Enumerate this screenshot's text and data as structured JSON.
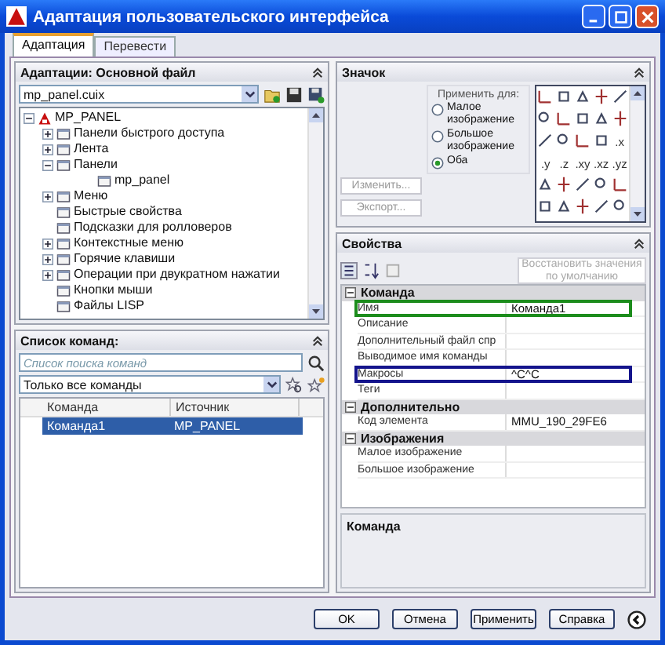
{
  "window": {
    "title": "Адаптация пользовательского интерфейса"
  },
  "tabs": [
    {
      "label": "Адаптация",
      "selected": true
    },
    {
      "label": "Перевести",
      "selected": false
    }
  ],
  "customizations_panel": {
    "title": "Адаптации: Основной файл",
    "expanded": true,
    "file": "mp_panel.cuix",
    "tree": [
      {
        "label": "MP_PANEL",
        "expanded": true,
        "children": [
          {
            "label": "Панели быстрого доступа",
            "expanded": false
          },
          {
            "label": "Лента",
            "expanded": false
          },
          {
            "label": "Панели",
            "expanded": true,
            "children": [
              {
                "label": "mp_panel"
              }
            ]
          },
          {
            "label": "Меню",
            "expanded": false
          },
          {
            "label": "Быстрые свойства"
          },
          {
            "label": "Подсказки для ролловеров"
          },
          {
            "label": "Контекстные меню",
            "expanded": false
          },
          {
            "label": "Горячие клавиши",
            "expanded": false
          },
          {
            "label": "Операции при двукратном нажатии",
            "expanded": false
          },
          {
            "label": "Кнопки мыши"
          },
          {
            "label": "Файлы LISP"
          }
        ]
      }
    ]
  },
  "command_list": {
    "title": "Список команд:",
    "expanded": true,
    "search": {
      "placeholder": "Список поиска команд"
    },
    "filter": "Только все команды",
    "columns": [
      "Команда",
      "Источник"
    ],
    "rows": [
      {
        "cells": [
          "Команда1",
          "MP_PANEL"
        ],
        "selected": true
      }
    ]
  },
  "icon_panel": {
    "title": "Значок",
    "expanded": true,
    "apply_label": "Применить для:",
    "options": [
      {
        "label": "Малое изображение",
        "selected": false
      },
      {
        "label": "Большое изображение",
        "selected": false
      },
      {
        "label": "Оба",
        "selected": true
      }
    ],
    "buttons": [
      {
        "label": "Изменить...",
        "disabled": true
      },
      {
        "label": "Экспорт...",
        "disabled": true
      }
    ],
    "icons": [
      {
        "kind": "icon"
      },
      {
        "kind": "icon"
      },
      {
        "kind": "icon"
      },
      {
        "kind": "icon"
      },
      {
        "kind": "icon"
      },
      {
        "kind": "icon"
      },
      {
        "kind": "icon"
      },
      {
        "kind": "icon"
      },
      {
        "kind": "icon"
      },
      {
        "kind": "icon"
      },
      {
        "kind": "icon"
      },
      {
        "kind": "icon"
      },
      {
        "kind": "icon"
      },
      {
        "kind": "icon"
      },
      {
        "kind": "text",
        "label": ".x"
      },
      {
        "kind": "text",
        "label": ".y"
      },
      {
        "kind": "text",
        "label": ".z"
      },
      {
        "kind": "text",
        "label": ".xy"
      },
      {
        "kind": "text",
        "label": ".xz"
      },
      {
        "kind": "text",
        "label": ".yz"
      },
      {
        "kind": "icon"
      },
      {
        "kind": "icon"
      },
      {
        "kind": "icon"
      },
      {
        "kind": "icon"
      },
      {
        "kind": "icon"
      },
      {
        "kind": "icon"
      },
      {
        "kind": "icon"
      },
      {
        "kind": "icon"
      },
      {
        "kind": "icon"
      },
      {
        "kind": "icon"
      }
    ]
  },
  "properties_panel": {
    "title": "Свойства",
    "expanded": true,
    "reset_button": {
      "label": "Восстановить значения по умолчанию",
      "disabled": true
    },
    "categories": [
      {
        "name": "Команда",
        "expanded": true,
        "rows": [
          {
            "name": "Имя",
            "value": "Команда1",
            "color": "#1c8c1c"
          },
          {
            "name": "Описание"
          },
          {
            "name": "Дополнительный файл спр"
          },
          {
            "name": "Выводимое имя команды"
          },
          {
            "name": "Макросы",
            "value": "^C^C",
            "color": "#14148c"
          },
          {
            "name": "Теги"
          }
        ]
      },
      {
        "name": "Дополнительно",
        "expanded": true,
        "rows": [
          {
            "name": "Код элемента",
            "value": "MMU_190_29FE6"
          }
        ]
      },
      {
        "name": "Изображения",
        "expanded": true,
        "rows": [
          {
            "name": "Малое изображение"
          },
          {
            "name": "Большое изображение"
          }
        ]
      }
    ],
    "description_title": "Команда"
  },
  "footer_buttons": [
    "OK",
    "Отмена",
    "Применить",
    "Справка"
  ]
}
